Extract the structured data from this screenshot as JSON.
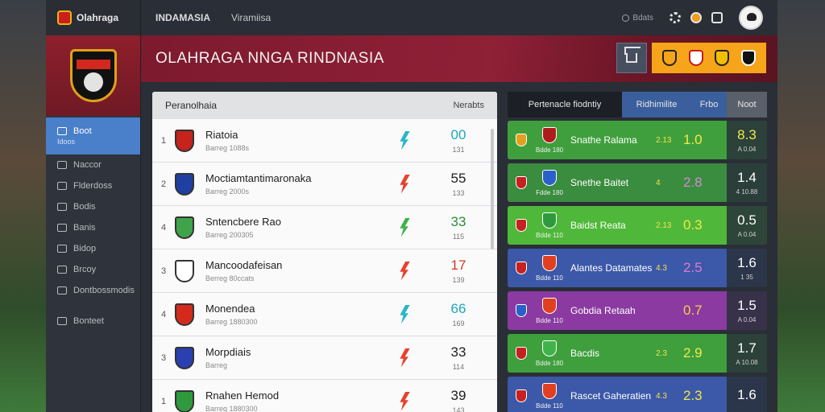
{
  "brand": {
    "name": "Olahraga"
  },
  "sidebar": {
    "items": [
      {
        "label": "Boot",
        "sub": "Idoos",
        "icon": "grid-icon",
        "active": true
      },
      {
        "label": "Naccor",
        "icon": "gear-icon"
      },
      {
        "label": "Flderdoss",
        "icon": "list-icon"
      },
      {
        "label": "Bodis",
        "icon": "doc-icon"
      },
      {
        "label": "Banis",
        "icon": "doc-icon"
      },
      {
        "label": "Bidop",
        "icon": "doc-icon"
      },
      {
        "label": "Brcoy",
        "icon": "doc-icon"
      },
      {
        "label": "Dontbossmodis",
        "icon": "check-icon"
      },
      {
        "label": "Bonteet",
        "icon": "user-icon"
      }
    ]
  },
  "topbar": {
    "tab1": "INDAMASIA",
    "tab2": "Viramiisa",
    "search_placeholder": "Bdats"
  },
  "banner": {
    "title": "OLAHRAGA  NNGA RINDNASIA"
  },
  "standings": {
    "title": "Peranolhaia",
    "col_right": "Nerabts",
    "rows": [
      {
        "rank": "1",
        "name": "Riatoia",
        "sub": "Barreg 1088s",
        "score": "00",
        "score_sub": "131",
        "trend": "teal",
        "crest": "#c5231c",
        "score_color": "teal"
      },
      {
        "rank": "2",
        "name": "Moctiamtantimaronaka",
        "sub": "Barreg 2000s",
        "score": "55",
        "score_sub": "133",
        "trend": "red",
        "crest": "#1f3fa3",
        "score_color": "dark"
      },
      {
        "rank": "4",
        "name": "Sntencbere Rao",
        "sub": "Barreg 200305",
        "score": "33",
        "score_sub": "115",
        "trend": "green",
        "crest": "#3fa34a",
        "score_color": "green"
      },
      {
        "rank": "3",
        "name": "Mancoodafeisan",
        "sub": "Berreg 80ccats",
        "score": "17",
        "score_sub": "139",
        "trend": "red",
        "crest": "#ffffff",
        "score_color": "red"
      },
      {
        "rank": "4",
        "name": "Monendea",
        "sub": "Barreg 1880300",
        "score": "66",
        "score_sub": "169",
        "trend": "teal",
        "crest": "#d42a1c",
        "score_color": "teal"
      },
      {
        "rank": "3",
        "name": "Morpdiais",
        "sub": "Barreg",
        "score": "33",
        "score_sub": "114",
        "trend": "red",
        "crest": "#2a3fb0",
        "score_color": "dark"
      },
      {
        "rank": "1",
        "name": "Rnahen Hemod",
        "sub": "Barreg 1880300",
        "score": "39",
        "score_sub": "143",
        "trend": "red",
        "crest": "#2f9a3d",
        "score_color": "dark"
      }
    ]
  },
  "matches": {
    "tabs": [
      "Pertenacle fiodntiy",
      "Ridhimilite",
      "Frbo",
      "Noot"
    ],
    "rows": [
      {
        "name": "Snathe Ralama",
        "meta": "Bdde 180",
        "mini": "2.13",
        "odds": "1.0",
        "big": "8.3",
        "small": "A 0.04",
        "bg": "#3f9f3d",
        "odds_color": "#f2e84a",
        "big_color": "#f2e84a",
        "c1": "#e4a01c",
        "c2": "#b01c1c"
      },
      {
        "name": "Snethe Baitet",
        "meta": "Fdde 180",
        "mini": "4",
        "odds": "2.8",
        "big": "1.4",
        "small": "4 10.88",
        "bg": "#3a8c3e",
        "odds_color": "#d08ad8",
        "big_color": "#ffffff",
        "c1": "#c62020",
        "c2": "#2a60c8"
      },
      {
        "name": "Baidst Reata",
        "meta": "Bdde 110",
        "mini": "2.13",
        "odds": "0.3",
        "big": "0.5",
        "small": "A 0.04",
        "bg": "#4fb83a",
        "odds_color": "#f2e84a",
        "big_color": "#ffffff",
        "c1": "#c62020",
        "c2": "#2f9a3d"
      },
      {
        "name": "Alantes Datamates",
        "meta": "Bdde 110",
        "mini": "4.3",
        "odds": "2.5",
        "big": "1.6",
        "small": "1 35",
        "bg": "#3c58a8",
        "odds_color": "#e07ad0",
        "big_color": "#ffffff",
        "c1": "#c62020",
        "c2": "#e04020"
      },
      {
        "name": "Gobdia Retaah",
        "meta": "Bdde 110",
        "mini": "",
        "odds": "0.7",
        "big": "1.5",
        "small": "A 0.04",
        "bg": "#8a3aa0",
        "odds_color": "#f2d04a",
        "big_color": "#ffffff",
        "c1": "#2a60c8",
        "c2": "#e04020"
      },
      {
        "name": "Bacdis",
        "meta": "Bdde 180",
        "mini": "2.3",
        "odds": "2.9",
        "big": "1.7",
        "small": "A 10.08",
        "bg": "#3f9f3d",
        "odds_color": "#f2e84a",
        "big_color": "#ffffff",
        "c1": "#c62020",
        "c2": "#3fb34a"
      },
      {
        "name": "Rascet Gaheratien",
        "meta": "Bdde 110",
        "mini": "4.3",
        "odds": "2.3",
        "big": "1.6",
        "small": "",
        "bg": "#3c58a8",
        "odds_color": "#f2e84a",
        "big_color": "#ffffff",
        "c1": "#c62020",
        "c2": "#e04020"
      }
    ]
  }
}
